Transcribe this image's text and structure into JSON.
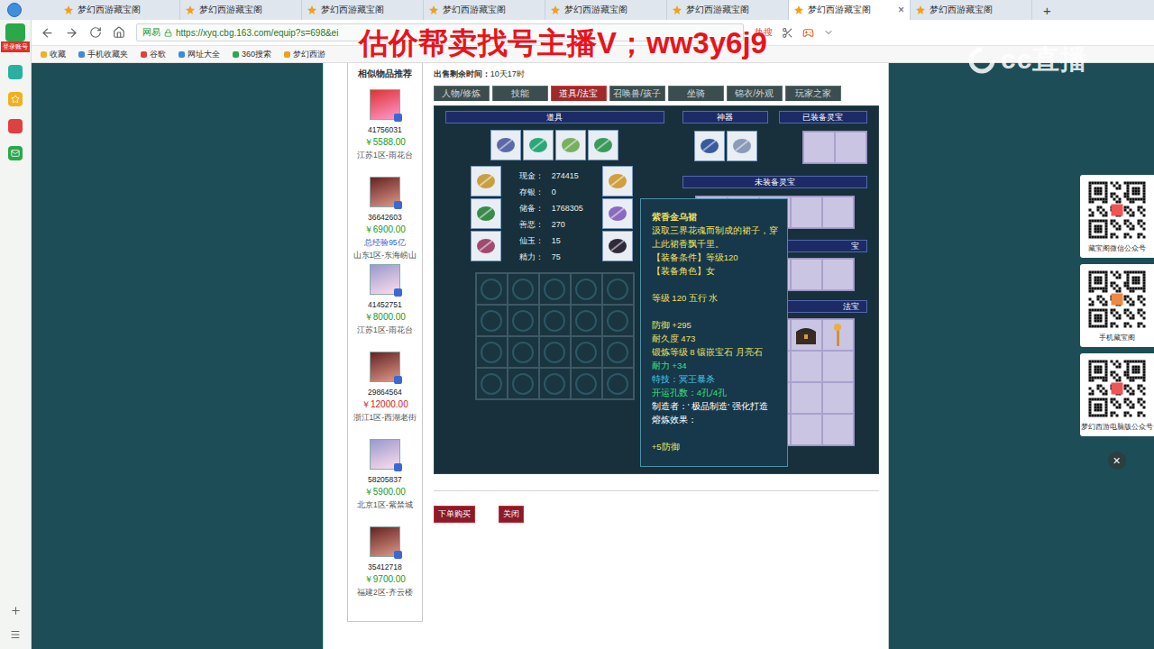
{
  "browser": {
    "tabs": [
      {
        "label": "梦幻西游藏宝阁",
        "selected": false
      },
      {
        "label": "梦幻西游藏宝阁",
        "selected": false
      },
      {
        "label": "梦幻西游藏宝阁",
        "selected": false
      },
      {
        "label": "梦幻西游藏宝阁",
        "selected": false
      },
      {
        "label": "梦幻西游藏宝阁",
        "selected": false
      },
      {
        "label": "梦幻西游藏宝阁",
        "selected": false
      },
      {
        "label": "梦幻西游藏宝阁",
        "selected": true
      },
      {
        "label": "梦幻西游藏宝阁",
        "selected": false
      }
    ],
    "new_tab": "+",
    "close_tab": "×",
    "address": {
      "site": "网易",
      "url": "https://xyq.cbg.163.com/equip?s=698&ei"
    },
    "hot": "热搜",
    "bookmarks": [
      "收藏",
      "手机收藏夹",
      "谷歌",
      "网址大全",
      "360搜索",
      "梦幻西游"
    ]
  },
  "sidebar": {
    "login": "登录账号"
  },
  "watermark": "估价帮卖找号主播V；ww3y6j9",
  "stream_logo": "cc直播",
  "recommend": {
    "title": "相似物品推荐",
    "items": [
      {
        "id": "41756031",
        "price": "￥5588.00",
        "note": "",
        "server": "江苏1区-雨花台",
        "color": "#1a9a1a"
      },
      {
        "id": "36642603",
        "price": "￥6900.00",
        "note": "总经验95亿",
        "server": "山东1区-东海崂山",
        "color": "#1a9a1a"
      },
      {
        "id": "41452751",
        "price": "￥8000.00",
        "note": "",
        "server": "江苏1区-雨花台",
        "color": "#1a9a1a"
      },
      {
        "id": "29864564",
        "price": "￥12000.00",
        "note": "",
        "server": "浙江1区-西湖老街",
        "color": "#d01818"
      },
      {
        "id": "58205837",
        "price": "￥5900.00",
        "note": "",
        "server": "北京1区-紫禁城",
        "color": "#1a9a1a"
      },
      {
        "id": "35412718",
        "price": "￥9700.00",
        "note": "",
        "server": "福建2区-齐云楼",
        "color": "#1a9a1a"
      }
    ]
  },
  "sale_time": {
    "label": "出售剩余时间：",
    "value": "10天17时"
  },
  "tabs": [
    {
      "label": "人物/修炼",
      "selected": false
    },
    {
      "label": "技能",
      "selected": false
    },
    {
      "label": "道具/法宝",
      "selected": true
    },
    {
      "label": "召唤兽/孩子",
      "selected": false
    },
    {
      "label": "坐骑",
      "selected": false
    },
    {
      "label": "锦衣/外观",
      "selected": false
    },
    {
      "label": "玩家之家",
      "selected": false
    }
  ],
  "inventory": {
    "title": "道具",
    "stats": [
      {
        "label": "现金：",
        "value": "274415"
      },
      {
        "label": "存银：",
        "value": "0"
      },
      {
        "label": "储备：",
        "value": "1768305"
      },
      {
        "label": "善恶：",
        "value": "270"
      },
      {
        "label": "仙玉：",
        "value": "15"
      },
      {
        "label": "精力：",
        "value": "75"
      }
    ]
  },
  "artifact": {
    "title": "神器"
  },
  "spirit": {
    "equipped": "已装备灵宝",
    "unequipped": "未装备灵宝"
  },
  "hidden_headers": [
    "宝",
    "法宝"
  ],
  "tooltip": {
    "title": "紫香金乌裙",
    "lines": [
      {
        "kind": "text",
        "text": "汲取三界花魂而制成的裙子，穿上此裙香飘千里。",
        "color": "#f0e060"
      },
      {
        "kind": "text",
        "text": "【装备条件】等级120",
        "color": "#f0e060"
      },
      {
        "kind": "text",
        "text": "【装备角色】女",
        "color": "#f0e060"
      },
      {
        "kind": "spacer"
      },
      {
        "kind": "text",
        "text": "等级 120  五行 水",
        "color": "#f0e060"
      },
      {
        "kind": "spacer"
      },
      {
        "kind": "text",
        "text": "防御 +295",
        "color": "#f0e060"
      },
      {
        "kind": "text",
        "text": "耐久度 473",
        "color": "#f0e060"
      },
      {
        "kind": "text",
        "text": "锻炼等级 8  镶嵌宝石 月亮石",
        "color": "#f0e060"
      },
      {
        "kind": "text",
        "text": "耐力 +34",
        "color": "#3ee07a"
      },
      {
        "kind": "text",
        "text": "特技：冥王暴杀",
        "color": "#4ac8e8"
      },
      {
        "kind": "text",
        "text": "开运孔数：4孔/4孔",
        "color": "#3ee07a"
      },
      {
        "kind": "text",
        "text": "制造者：' 极品制造' 强化打造",
        "color": "#ffffff"
      },
      {
        "kind": "text",
        "text": "熔炼效果：",
        "color": "#ffffff"
      },
      {
        "kind": "spacer"
      },
      {
        "kind": "text",
        "text": "+5防御",
        "color": "#f0e060"
      }
    ]
  },
  "buttons": [
    {
      "label": "下单购买"
    },
    {
      "label": "关闭"
    }
  ],
  "side_cards": [
    {
      "caption": "藏宝阁微信公众号"
    },
    {
      "caption": "手机藏宝阁"
    },
    {
      "caption": "梦幻西游电脑版公众号"
    }
  ],
  "side_close": "×"
}
